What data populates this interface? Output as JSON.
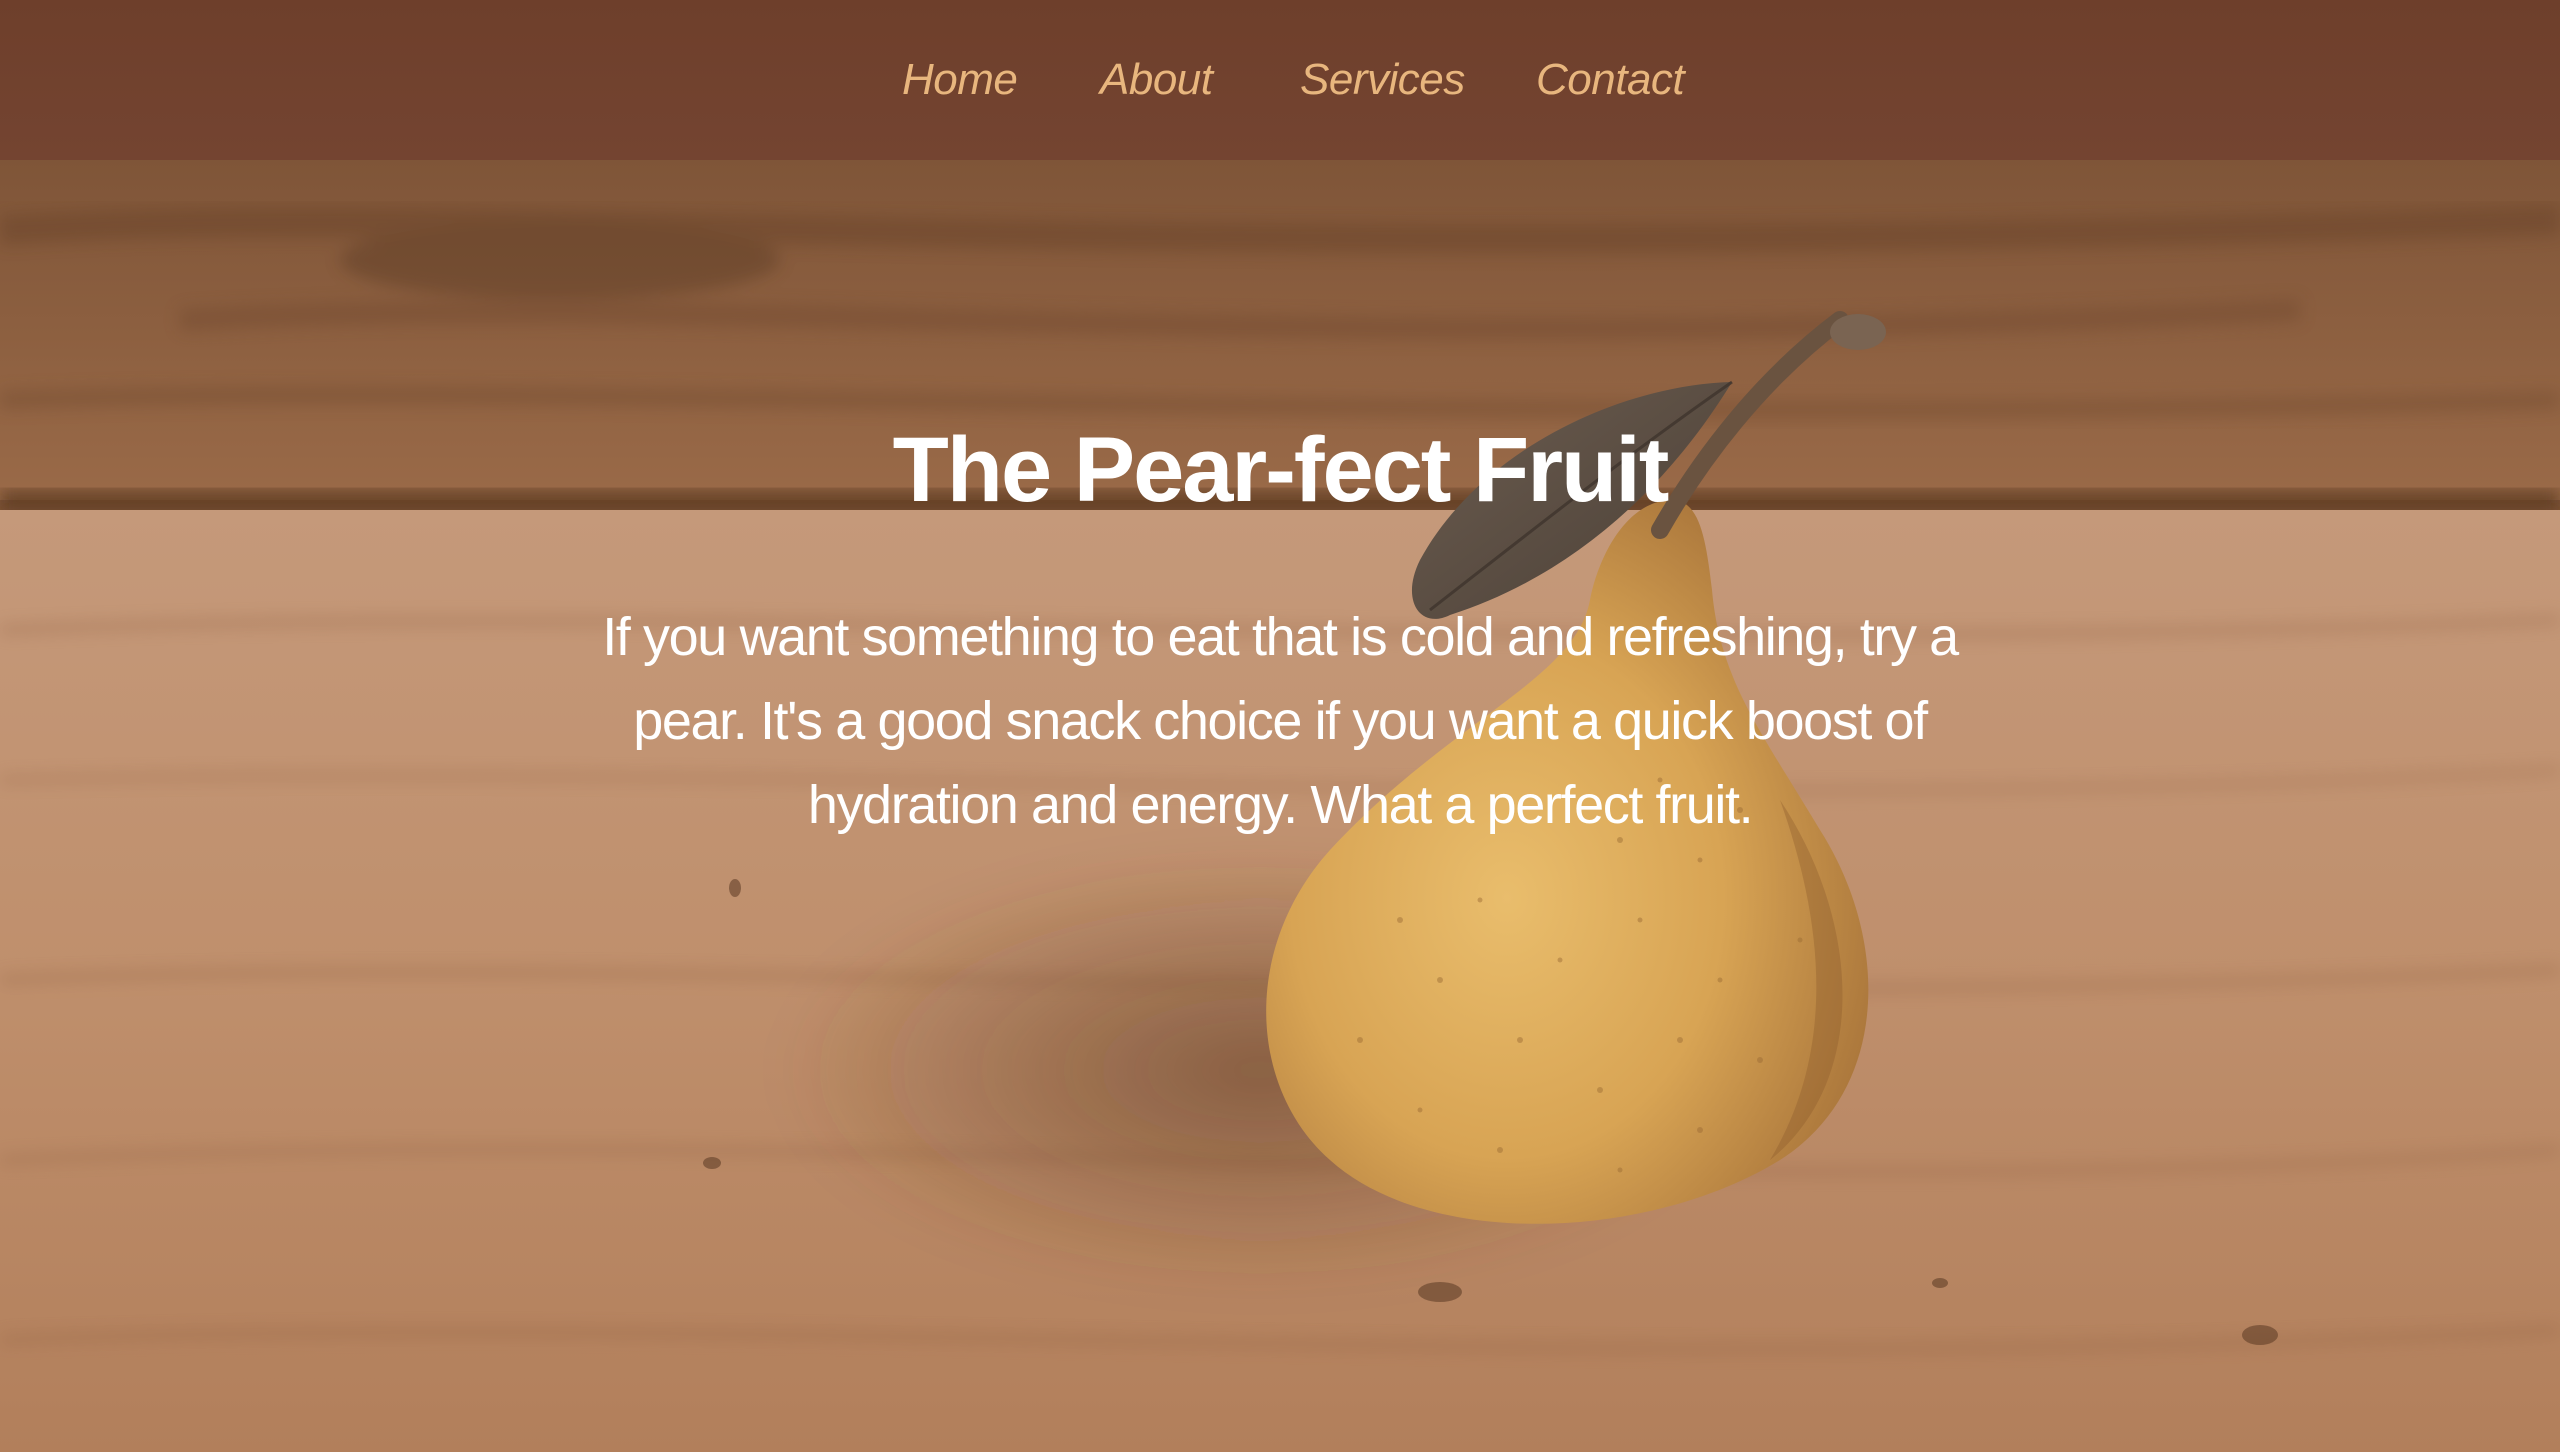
{
  "nav": {
    "items": [
      {
        "label": "Home"
      },
      {
        "label": "About"
      },
      {
        "label": "Services"
      },
      {
        "label": "Contact"
      }
    ]
  },
  "hero": {
    "title": "The Pear-fect Fruit",
    "text": "If you want something to eat that is cold and refreshing, try a pear. It's a good snack choice if you want a quick boost of hydration and energy. What a perfect fruit."
  },
  "colors": {
    "navbar_background": "#6e3f2b",
    "nav_link": "#e8b67e",
    "hero_text": "#ffffff",
    "wood": "#b98967",
    "pear": "#d9a14f"
  }
}
